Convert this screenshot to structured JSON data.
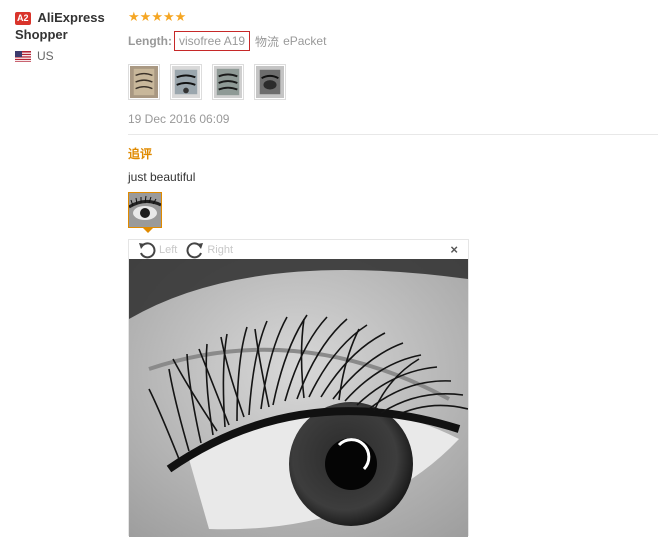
{
  "user": {
    "level_badge": "A2",
    "name_line1": "AliExpress",
    "name_line2": "Shopper",
    "country": "US"
  },
  "review": {
    "rating": 5,
    "attribute_label": "Length:",
    "attribute_value": "visofree A19",
    "shipping_label": "物流",
    "shipping_value": "ePacket",
    "date": "19 Dec 2016 06:09",
    "followup_label": "追评",
    "followup_text": "just beautiful"
  },
  "viewer": {
    "rotate_left_label": "Left",
    "rotate_right_label": "Right",
    "close_label": "×"
  },
  "colors": {
    "star": "#f5a623",
    "accent": "#e08a00",
    "highlight_box": "#c62828"
  }
}
